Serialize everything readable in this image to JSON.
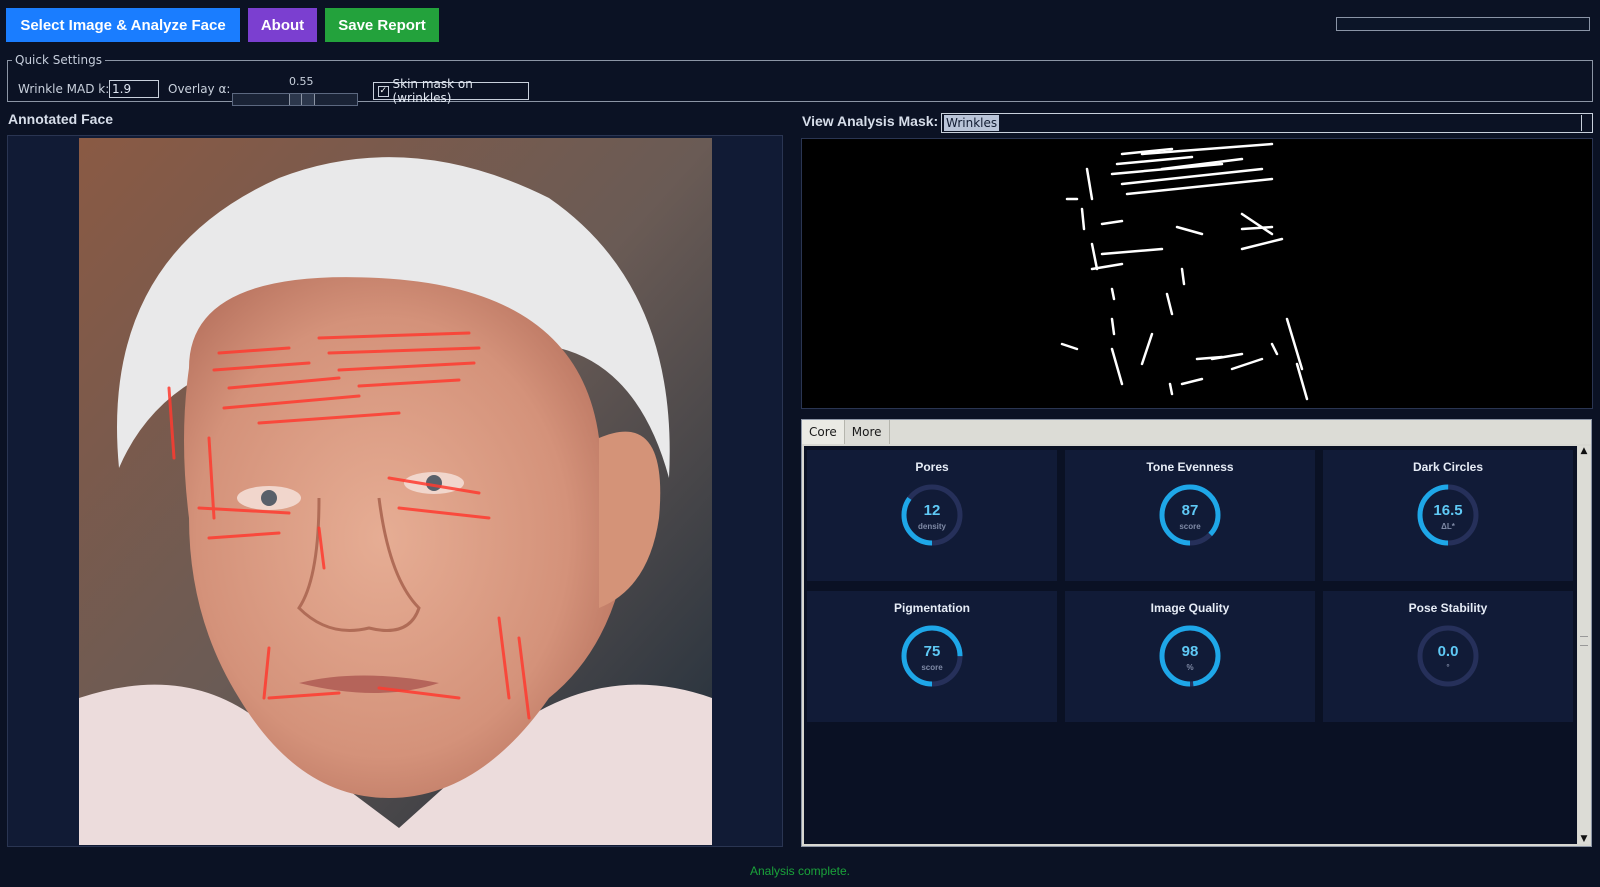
{
  "toolbar": {
    "select_label": "Select Image & Analyze Face",
    "about_label": "About",
    "save_label": "Save Report",
    "progress": 0
  },
  "quick_settings": {
    "legend": "Quick Settings",
    "mad_label": "Wrinkle MAD k:",
    "mad_value": "1.9",
    "overlay_label": "Overlay α:",
    "overlay_value": "0.55",
    "skin_mask_label": "Skin mask on (wrinkles)",
    "skin_mask_checked": true
  },
  "annotated": {
    "title": "Annotated Face"
  },
  "mask": {
    "label": "View Analysis Mask:",
    "selected": "Wrinkles"
  },
  "tabs": [
    {
      "label": "Core",
      "active": true
    },
    {
      "label": "More",
      "active": false
    }
  ],
  "metrics": [
    {
      "title": "Pores",
      "value": "12",
      "unit": "density",
      "fill": 0.35
    },
    {
      "title": "Tone Evenness",
      "value": "87",
      "unit": "score",
      "fill": 0.87
    },
    {
      "title": "Dark Circles",
      "value": "16.5",
      "unit": "ΔL*",
      "fill": 0.5
    },
    {
      "title": "Pigmentation",
      "value": "75",
      "unit": "score",
      "fill": 0.75
    },
    {
      "title": "Image Quality",
      "value": "98",
      "unit": "%",
      "fill": 0.98
    },
    {
      "title": "Pose Stability",
      "value": "0.0",
      "unit": "°",
      "fill": 0.0
    }
  ],
  "status": "Analysis complete.",
  "colors": {
    "gauge_track": "#26305a",
    "gauge_fill": "#1ea7e8",
    "wrinkle_overlay": "#ff3b30",
    "mask_stroke": "#ffffff"
  }
}
